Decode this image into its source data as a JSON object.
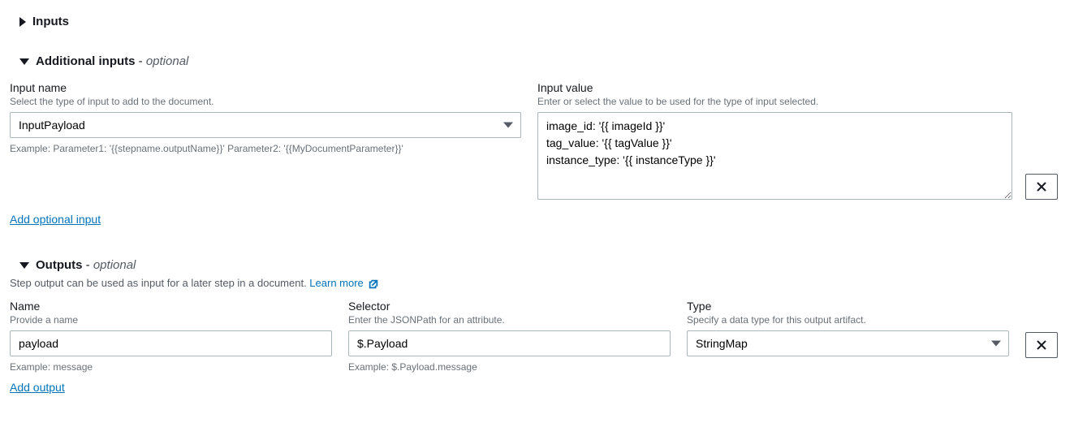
{
  "sections": {
    "inputs": {
      "title": "Inputs",
      "expanded": false
    },
    "additional_inputs": {
      "title": "Additional inputs",
      "optional_suffix": "optional",
      "expanded": true,
      "fields": {
        "input_name": {
          "label": "Input name",
          "help": "Select the type of input to add to the document.",
          "value": "InputPayload",
          "example": "Example: Parameter1: '{{stepname.outputName}}' Parameter2: '{{MyDocumentParameter}}'"
        },
        "input_value": {
          "label": "Input value",
          "help": "Enter or select the value to be used for the type of input selected.",
          "value": "image_id: '{{ imageId }}'\ntag_value: '{{ tagValue }}'\ninstance_type: '{{ instanceType }}'"
        }
      },
      "add_link": "Add optional input"
    },
    "outputs": {
      "title": "Outputs",
      "optional_suffix": "optional",
      "expanded": true,
      "desc_prefix": "Step output can be used as input for a later step in a document. ",
      "learn_more": "Learn more",
      "fields": {
        "name": {
          "label": "Name",
          "help": "Provide a name",
          "value": "payload",
          "example": "Example: message"
        },
        "selector": {
          "label": "Selector",
          "help": "Enter the JSONPath for an attribute.",
          "value": "$.Payload",
          "example": "Example: $.Payload.message"
        },
        "type": {
          "label": "Type",
          "help": "Specify a data type for this output artifact.",
          "value": "StringMap"
        }
      },
      "add_link": "Add output"
    }
  }
}
